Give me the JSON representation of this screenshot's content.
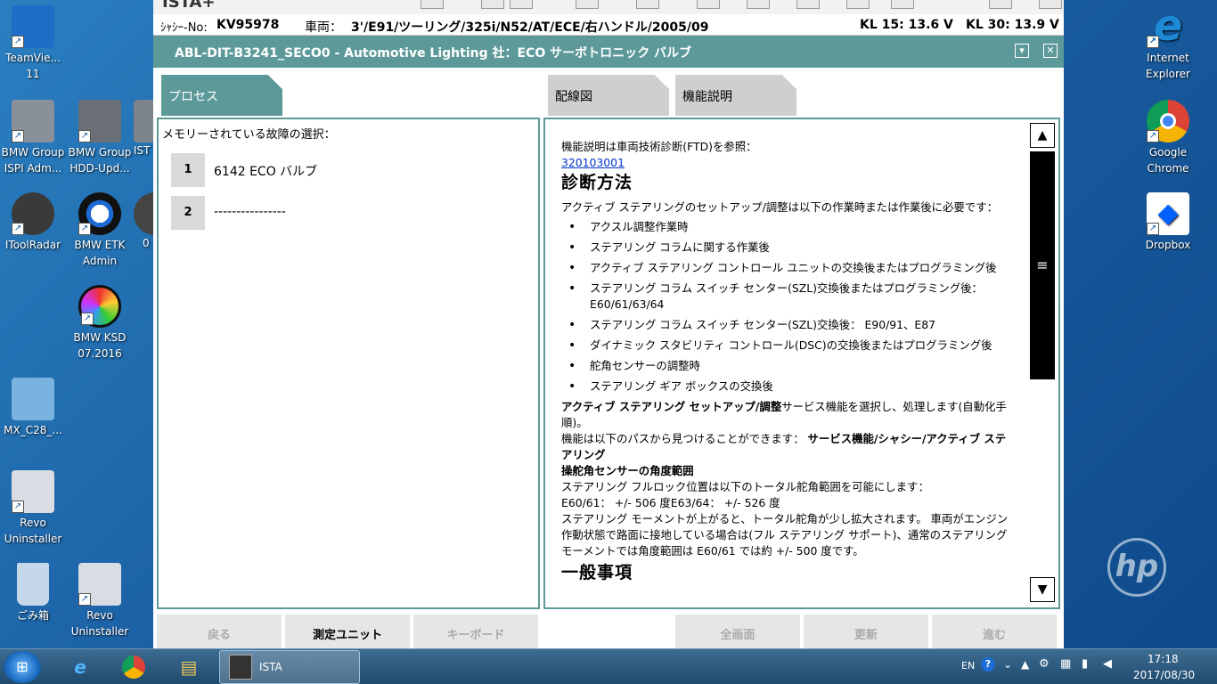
{
  "desktop": {
    "icons_left": [
      {
        "label": "TeamVie...\n11",
        "icon": "teamviewer-icon",
        "color": "#1e6ec8"
      },
      {
        "label": "BMW Group\nISPI Adm...",
        "icon": "ispi-admin-icon",
        "color": "#8a9099"
      },
      {
        "label": "BMW Group\nHDD-Upd...",
        "icon": "hdd-update-icon",
        "color": "#6b7078"
      },
      {
        "label": "IST",
        "icon": "ista-icon",
        "color": "#7d848c"
      },
      {
        "label": "IToolRadar",
        "icon": "itoolradar-icon",
        "color": "#3a3a3a"
      },
      {
        "label": "BMW ETK\nAdmin",
        "icon": "bmw-etk-icon",
        "color": "#2d2d2d"
      },
      {
        "label": "0",
        "icon": "bmw-app-icon",
        "color": "#444"
      },
      {
        "label": "BMW KSD\n07.2016",
        "icon": "bmw-ksd-icon",
        "color": "#111"
      },
      {
        "label": "MX_C28_...",
        "icon": "mx-file-icon",
        "color": "#7bb3e0"
      },
      {
        "label": "Revo\nUninstaller",
        "icon": "revo-uninstaller-icon",
        "color": "#d9dde3"
      },
      {
        "label": "ごみ箱",
        "icon": "recycle-bin-icon",
        "color": "#c5d8ea"
      },
      {
        "label": "Revo\nUninstaller",
        "icon": "revo-uninstaller-icon",
        "color": "#d9dde3"
      }
    ],
    "icons_right": [
      {
        "label": "Internet\nExplorer",
        "icon": "internet-explorer-icon",
        "color": "#1e8ad6"
      },
      {
        "label": "Google\nChrome",
        "icon": "chrome-icon",
        "color": "#db4437"
      },
      {
        "label": "Dropbox",
        "icon": "dropbox-icon",
        "color": "#ffffff"
      }
    ],
    "logo": "hp"
  },
  "ista": {
    "app_name": "ISTA+",
    "vin_label": "ｼｬｼｰ-No:",
    "vin": "KV95978",
    "vehicle_label": "車両：",
    "vehicle": "3'/E91/ツーリング/325i/N52/AT/ECE/右ハンドル/2005/09",
    "kl15": "KL 15:  13.6 V",
    "kl30": "KL 30:  13.9 V",
    "title": "ABL-DIT-B3241_SECO0  -  Automotive Lighting 社：ECO サーボトロニック バルブ",
    "tabs": {
      "process": "プロセス",
      "wiring": "配線図",
      "function": "機能説明"
    },
    "left_panel": {
      "heading": "メモリーされている故障の選択：",
      "faults": [
        {
          "num": "1",
          "label": "6142 ECO バルブ"
        },
        {
          "num": "2",
          "label": "----------------"
        }
      ]
    },
    "doc": {
      "ref_text": "機能説明は車両技術診断(FTD)を参照：",
      "ref_link": "320103001",
      "heading": "診断方法",
      "intro": "アクティブ ステアリングのセットアップ/調整は以下の作業時または作業後に必要です：",
      "bullets": [
        "アクスル調整作業時",
        "ステアリング コラムに関する作業後",
        "アクティブ ステアリング コントロール ユニットの交換後またはプログラミング後",
        "ステアリング コラム スイッチ センター(SZL)交換後またはプログラミング後：E60/61/63/64",
        "ステアリング コラム スイッチ センター(SZL)交換後： E90/91、E87",
        "ダイナミック スタビリティ コントロール(DSC)の交換後またはプログラミング後",
        "舵角センサーの調整時",
        "ステアリング ギア ボックスの交換後"
      ],
      "p1_bold": "アクティブ ステアリング セットアップ/調整",
      "p1_rest": "サービス機能を選択し、処理します(自動化手順)。",
      "p2_rest": "機能は以下のパスから見つけることができます：",
      "p2_bold": "サービス機能/シャシー/アクティブ ステアリング",
      "h3": "操舵角センサーの角度範囲",
      "p3": "ステアリング フルロック位置は以下のトータル舵角範囲を可能にします：",
      "p4": "E60/61： +/- 506 度E63/64： +/- 526 度",
      "p5": "ステアリング モーメントが上がると、トータル舵角が少し拡大されます。 車両がエンジン作動状態で路面に接地している場合は(フル ステアリング サポート)、通常のステアリング モーメントでは角度範囲は E60/61 では約 +/- 500 度です。",
      "cut": "一般事項"
    },
    "buttons": {
      "back": "戻る",
      "measure": "測定ユニット",
      "keyboard": "キーボード",
      "fullscreen": "全画面",
      "update": "更新",
      "next": "進む"
    }
  },
  "taskbar": {
    "task_label": "ISTA",
    "lang": "EN",
    "time": "17:18",
    "date": "2017/08/30"
  }
}
